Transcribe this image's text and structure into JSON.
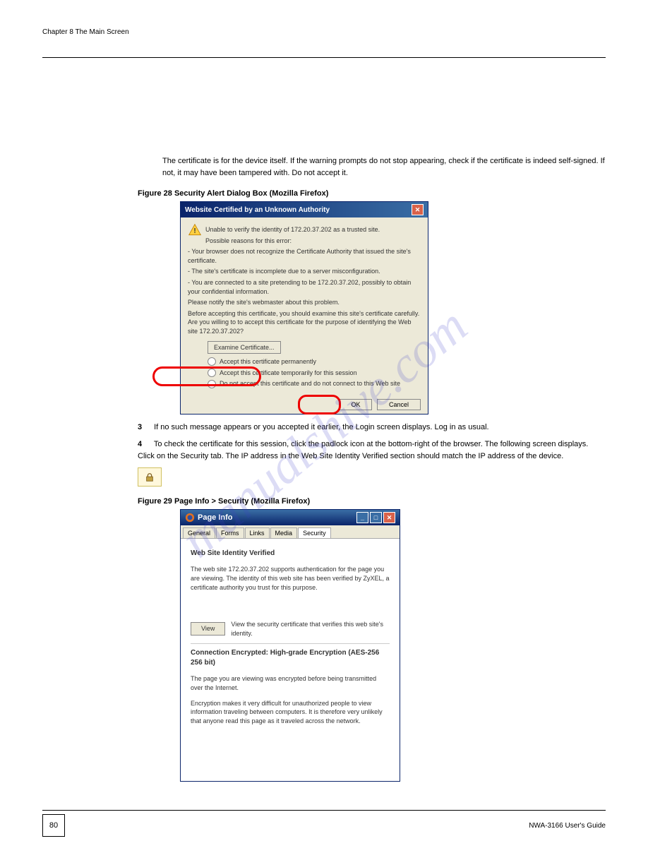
{
  "header": {
    "chapter": "Chapter 8 The Main Screen",
    "title": ""
  },
  "doc": {
    "intro1": "The certificate is for the device itself. If the warning prompts do not stop appearing, check if the certificate is indeed self-signed. If not, it may have been tampered with. Do not accept it.",
    "step3": "3",
    "step3_text": "If no such message appears or you accepted it earlier, the Login screen displays. Log in as usual.",
    "step4": "4",
    "step4_text": "To check the certificate for this session, click the padlock icon at the bottom-right of the browser. The following screen displays. Click on the Security tab. The IP address in the Web Site Identity Verified section should match the IP address of the device.",
    "figure1_label": "Figure 28   Security Alert Dialog Box (Mozilla Firefox)",
    "figure2_label": "Figure 29   Page Info > Security (Mozilla Firefox)"
  },
  "dialog1": {
    "title": "Website Certified by an Unknown Authority",
    "line1": "Unable to verify the identity of 172.20.37.202 as a trusted site.",
    "line2": "Possible reasons for this error:",
    "reason1": "- Your browser does not recognize the Certificate Authority that issued the site's certificate.",
    "reason2": "- The site's certificate is incomplete due to a server misconfiguration.",
    "reason3": "- You are connected to a site pretending to be 172.20.37.202, possibly to obtain your confidential information.",
    "line3": "Please notify the site's webmaster about this problem.",
    "line4": "Before accepting this certificate, you should examine this site's certificate carefully. Are you willing to to accept this certificate for the purpose of identifying the Web site 172.20.37.202?",
    "examine": "Examine Certificate...",
    "radio1": "Accept this certificate permanently",
    "radio2": "Accept this certificate temporarily for this session",
    "radio3": "Do not accept this certificate and do not connect to this Web site",
    "ok": "OK",
    "cancel": "Cancel"
  },
  "dialog2": {
    "title": "Page Info",
    "tabs": {
      "general": "General",
      "forms": "Forms",
      "links": "Links",
      "media": "Media",
      "security": "Security"
    },
    "heading1": "Web Site Identity Verified",
    "para1": "The web site 172.20.37.202 supports authentication for the page you are viewing. The identity of this web site has been verified by ZyXEL, a certificate authority you trust for this purpose.",
    "view": "View",
    "view_text": "View the security certificate that verifies this web site's identity.",
    "heading2": "Connection Encrypted: High-grade Encryption (AES-256 256 bit)",
    "para2": "The page you are viewing was encrypted before being transmitted over the Internet.",
    "para3": "Encryption makes it very difficult for unauthorized people to view information traveling between computers. It is therefore very unlikely that anyone read this page as it traveled across the network."
  },
  "footer": {
    "page": "80",
    "doc": "NWA-3166 User's Guide"
  },
  "watermark": "manualshive.com"
}
